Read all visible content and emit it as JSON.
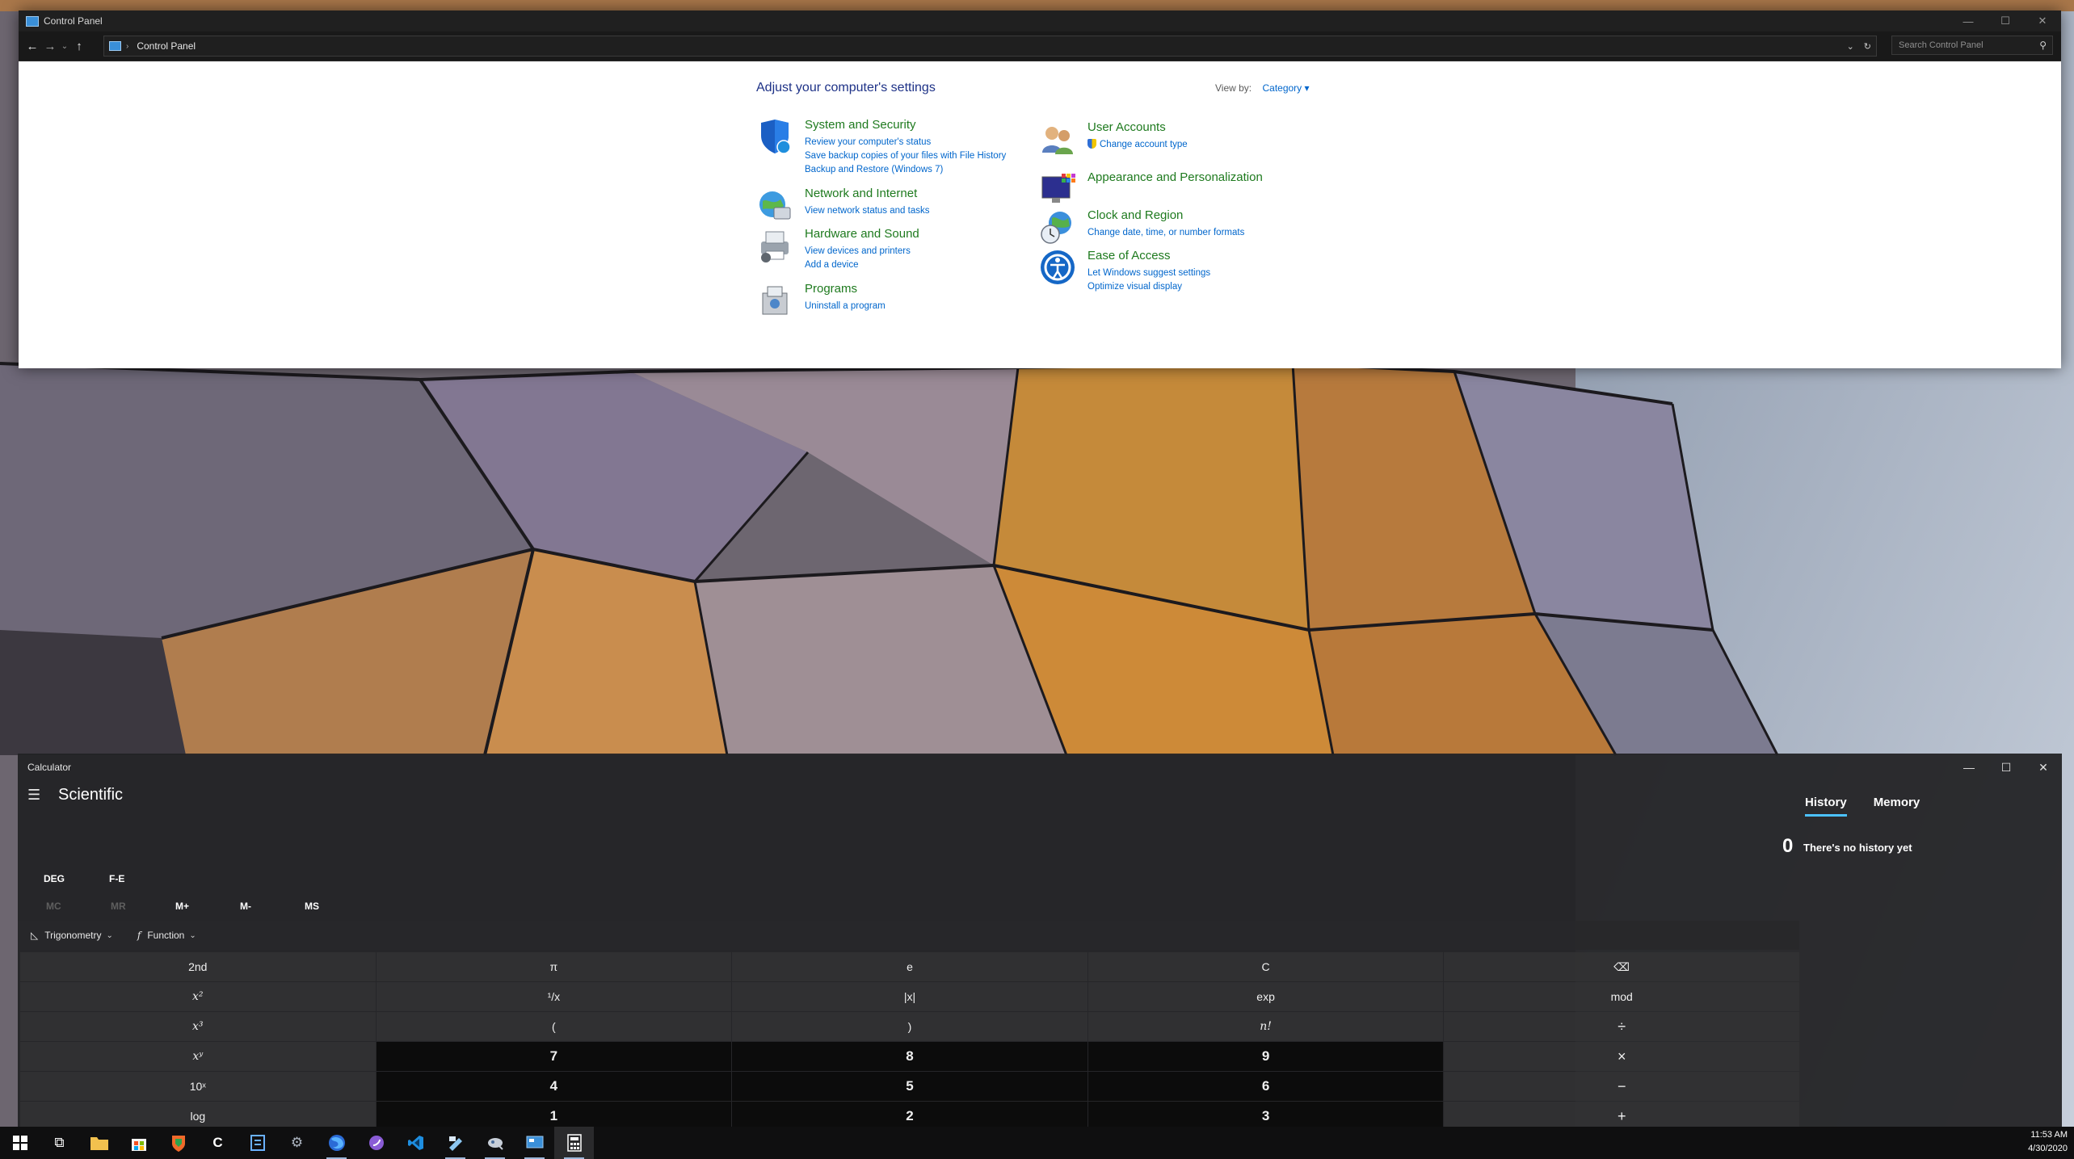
{
  "control_panel": {
    "title": "Control Panel",
    "address_crumb": "Control Panel",
    "search_placeholder": "Search Control Panel",
    "heading": "Adjust your computer's settings",
    "view_by_label": "View by:",
    "view_by_value": "Category ▾",
    "categories_left": [
      {
        "title": "System and Security",
        "icon": "shield-icon",
        "links": [
          "Review your computer's status",
          "Save backup copies of your files with File History",
          "Backup and Restore (Windows 7)"
        ]
      },
      {
        "title": "Network and Internet",
        "icon": "network-globe-icon",
        "links": [
          "View network status and tasks"
        ]
      },
      {
        "title": "Hardware and Sound",
        "icon": "printer-icon",
        "links": [
          "View devices and printers",
          "Add a device"
        ]
      },
      {
        "title": "Programs",
        "icon": "programs-box-icon",
        "links": [
          "Uninstall a program"
        ]
      }
    ],
    "categories_right": [
      {
        "title": "User Accounts",
        "icon": "users-icon",
        "links": [
          "Change account type"
        ]
      },
      {
        "title": "Appearance and Personalization",
        "icon": "monitor-palette-icon",
        "links": []
      },
      {
        "title": "Clock and Region",
        "icon": "clock-globe-icon",
        "links": [
          "Change date, time, or number formats"
        ]
      },
      {
        "title": "Ease of Access",
        "icon": "ease-of-access-icon",
        "links": [
          "Let Windows suggest settings",
          "Optimize visual display"
        ]
      }
    ]
  },
  "calculator": {
    "title": "Calculator",
    "mode": "Scientific",
    "angle_unit": "DEG",
    "fe_label": "F-E",
    "memory_buttons": [
      "MC",
      "MR",
      "M+",
      "M-",
      "MS"
    ],
    "fn_bar": {
      "trigonometry": "Trigonometry",
      "function": "Function"
    },
    "history_tab": "History",
    "memory_tab": "Memory",
    "display_value": "0",
    "history_empty": "There's no history yet",
    "keys": [
      "2nd",
      "π",
      "e",
      "C",
      "⌫",
      "x²",
      "¹/x",
      "|x|",
      "exp",
      "mod",
      "x³",
      "(",
      ")",
      "n!",
      "÷",
      "xʸ",
      "7",
      "8",
      "9",
      "×",
      "10ˣ",
      "4",
      "5",
      "6",
      "−",
      "log",
      "1",
      "2",
      "3",
      "+"
    ]
  },
  "taskbar": {
    "icons": [
      "windows-start-icon",
      "task-view-icon",
      "file-explorer-icon",
      "store-icon",
      "brave-icon",
      "ccleaner-icon",
      "notepad-icon",
      "settings-gear-icon",
      "firefox-icon",
      "app-purple-icon",
      "vscode-icon",
      "paint-icon",
      "tool-icon",
      "control-panel-icon",
      "calculator-icon"
    ],
    "time": "11:53 AM",
    "date": "4/30/2020"
  }
}
